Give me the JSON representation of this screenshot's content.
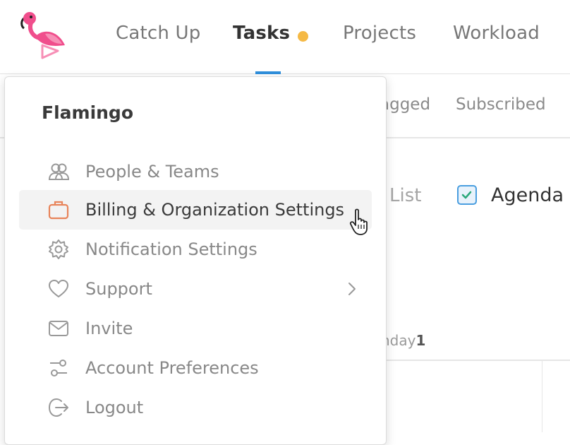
{
  "nav": {
    "tabs": [
      {
        "label": "Catch Up"
      },
      {
        "label": "Tasks"
      },
      {
        "label": "Projects"
      },
      {
        "label": "Workload"
      }
    ]
  },
  "subtabs": {
    "items": [
      {
        "label": "agged"
      },
      {
        "label": "Subscribed"
      }
    ]
  },
  "views": {
    "list_label": "List",
    "agenda_label": "Agenda"
  },
  "calendar": {
    "day_label": "nday",
    "day_number": "1"
  },
  "menu": {
    "title": "Flamingo",
    "items": [
      {
        "label": "People & Teams",
        "icon": "people-icon"
      },
      {
        "label": "Billing & Organization Settings",
        "icon": "briefcase-icon"
      },
      {
        "label": "Notification Settings",
        "icon": "gear-icon"
      },
      {
        "label": "Support",
        "icon": "heart-icon"
      },
      {
        "label": "Invite",
        "icon": "envelope-icon"
      },
      {
        "label": "Account Preferences",
        "icon": "sliders-icon"
      },
      {
        "label": "Logout",
        "icon": "logout-icon"
      }
    ]
  },
  "colors": {
    "accent": "#2f8fdc",
    "tasks_dot": "#f5b945",
    "billing_icon": "#e8845a",
    "logo_pink": "#f04e8c"
  }
}
